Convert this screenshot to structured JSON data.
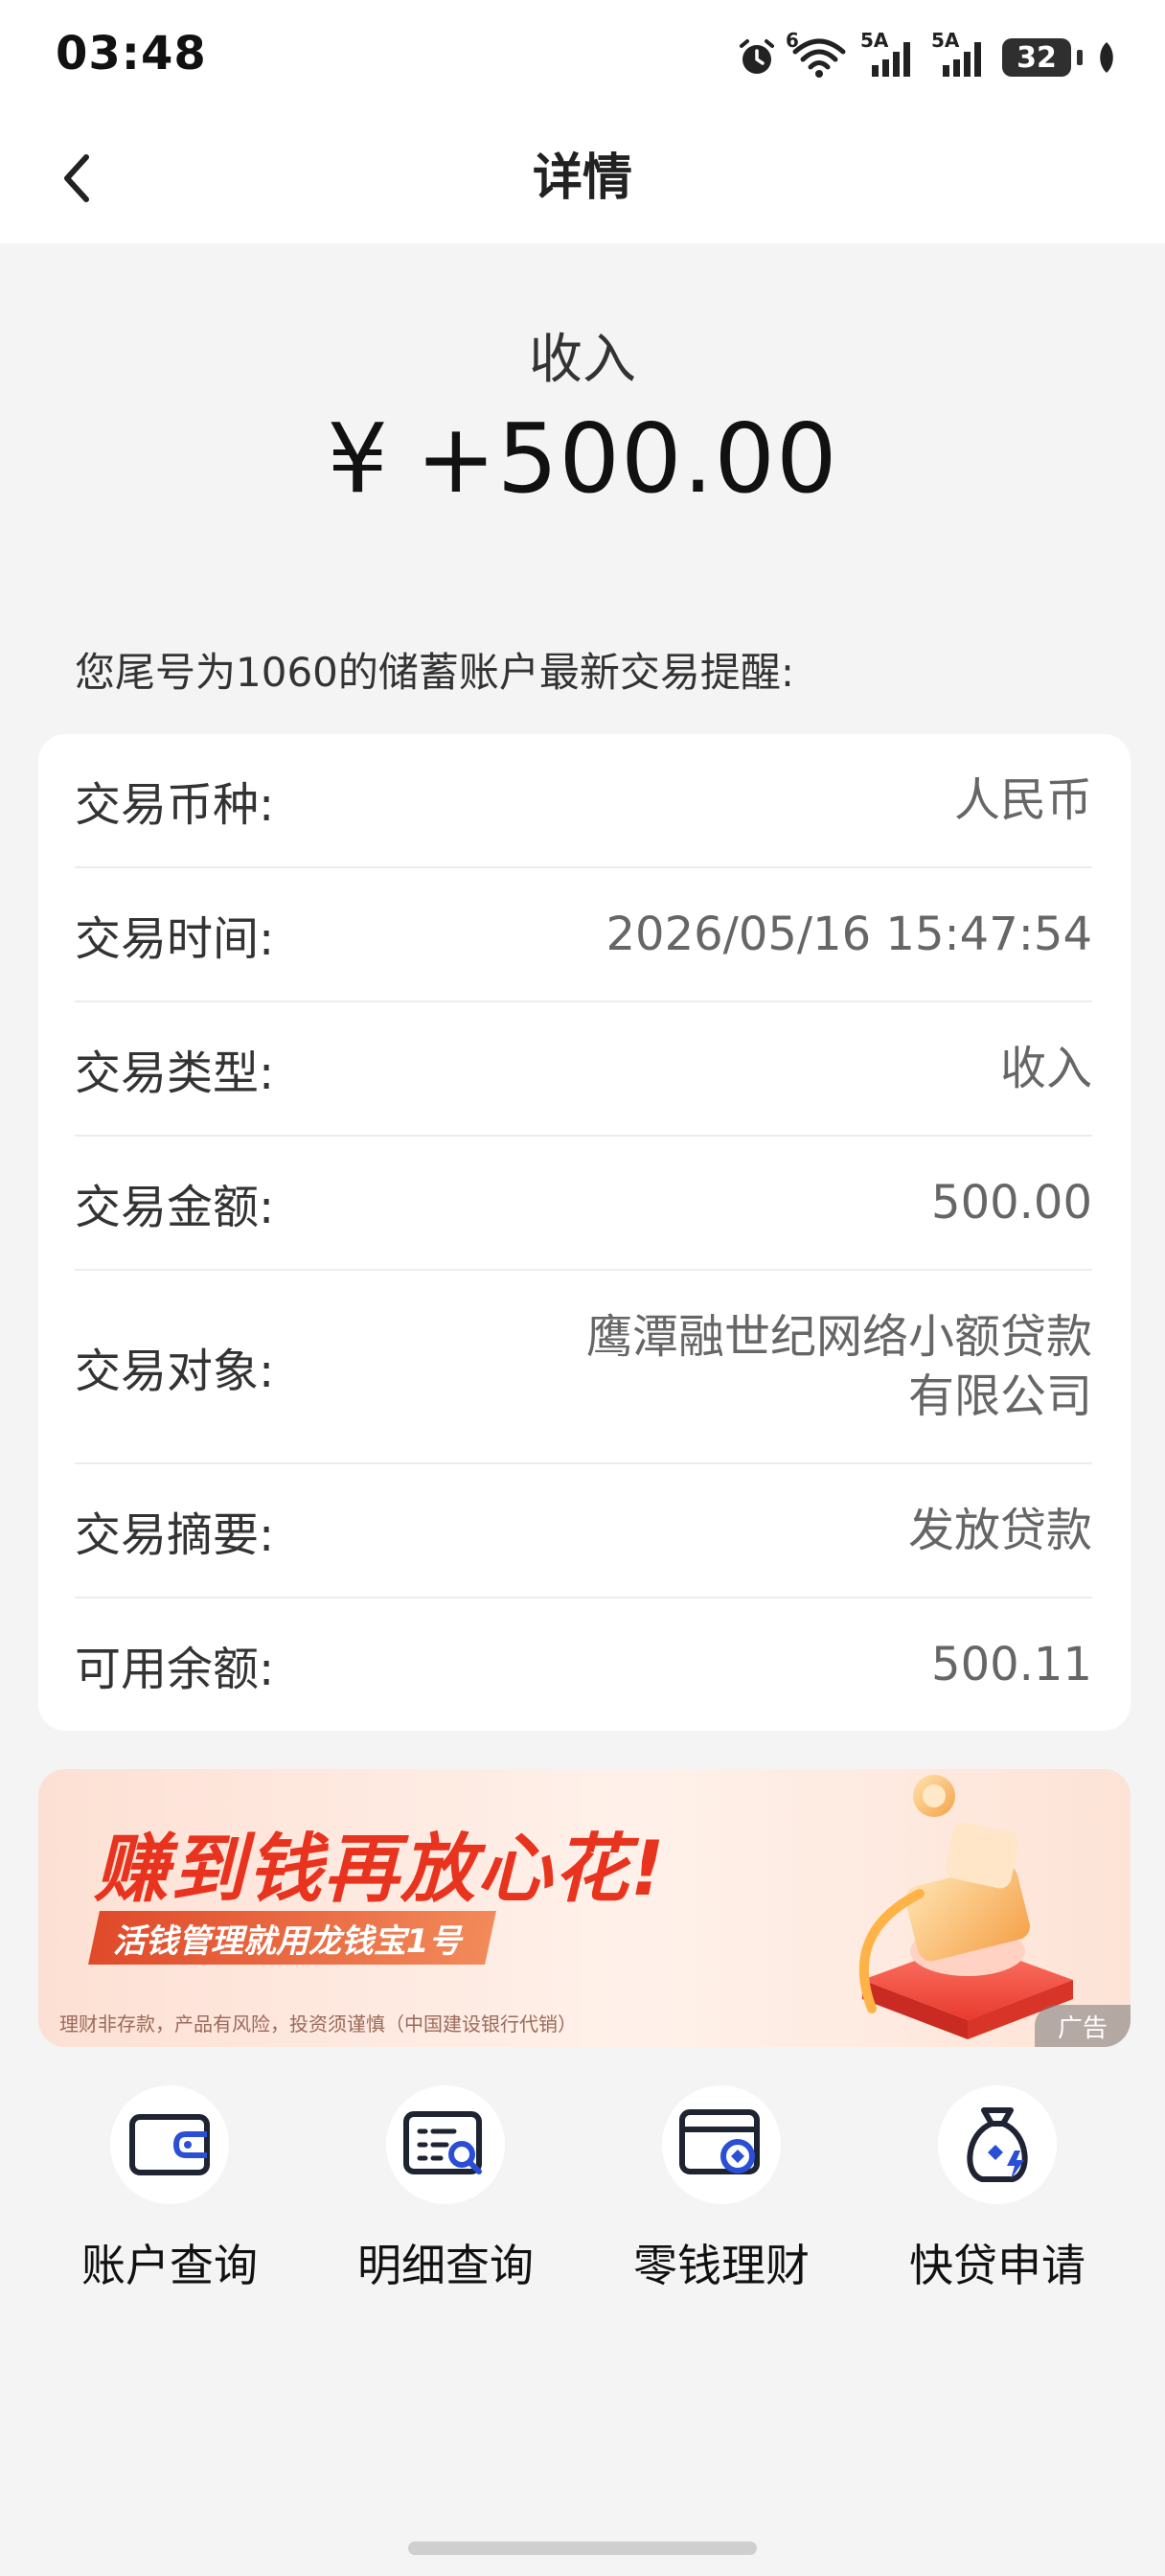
{
  "status_bar": {
    "time": "03:48",
    "wifi_label": "6",
    "signal1_label": "5A",
    "signal2_label": "5A",
    "battery": "32"
  },
  "nav": {
    "title": "详情"
  },
  "header": {
    "type_label": "收入",
    "currency_symbol": "¥",
    "amount": "+500.00"
  },
  "notice": "您尾号为1060的储蓄账户最新交易提醒:",
  "details": [
    {
      "label": "交易币种:",
      "value": [
        "人民币"
      ]
    },
    {
      "label": "交易时间:",
      "value": [
        "2026/05/16 15:47:54"
      ]
    },
    {
      "label": "交易类型:",
      "value": [
        "收入"
      ]
    },
    {
      "label": "交易金额:",
      "value": [
        "500.00"
      ]
    },
    {
      "label": "交易对象:",
      "value": [
        "鹰潭融世纪网络小额贷款",
        "有限公司"
      ]
    },
    {
      "label": "交易摘要:",
      "value": [
        "发放贷款"
      ]
    },
    {
      "label": "可用余额:",
      "value": [
        "500.11"
      ]
    }
  ],
  "banner": {
    "headline": "赚到钱再放心花!",
    "subline": "活钱管理就用龙钱宝1号",
    "disclaimer": "理财非存款，产品有风险，投资须谨慎（中国建设银行代销）",
    "ad_tag": "广告"
  },
  "quick_actions": [
    {
      "label": "账户查询",
      "icon": "wallet-icon"
    },
    {
      "label": "明细查询",
      "icon": "detail-search-icon"
    },
    {
      "label": "零钱理财",
      "icon": "card-coin-icon"
    },
    {
      "label": "快贷申请",
      "icon": "money-bag-icon"
    }
  ],
  "colors": {
    "accent_blue": "#2a4fd6",
    "icon_dark": "#1f2433",
    "banner_red": "#e8331e"
  }
}
